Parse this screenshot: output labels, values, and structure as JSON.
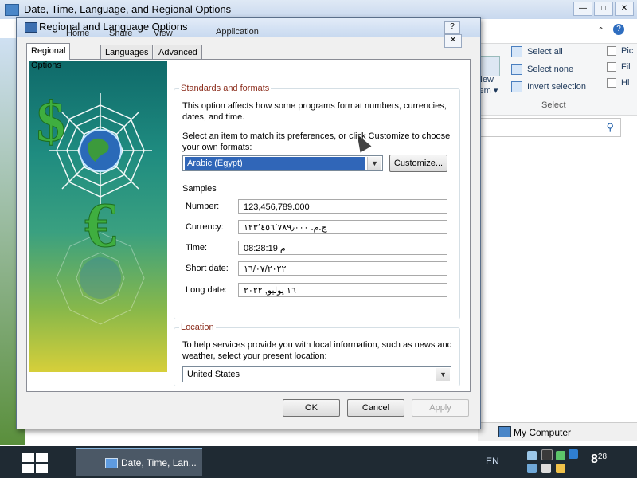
{
  "back_window": {
    "title": "Date, Time, Language, and Regional Options",
    "ribbon_tabs": [
      "Home",
      "Share",
      "View"
    ],
    "ribbon_app_tab": "Application",
    "select_all": "Select all",
    "select_none": "Select none",
    "invert_selection": "Invert selection",
    "select_group": "Select",
    "new_item_line1": "New",
    "new_item_line2": "item ▾",
    "check1": "Pic",
    "check2": "Fil",
    "check3": "Hi",
    "status": "My Computer"
  },
  "dialog": {
    "title": "Regional and Language Options",
    "tabs": [
      "Regional Options",
      "Languages",
      "Advanced"
    ],
    "standards": {
      "label": "Standards and formats",
      "desc": "This option affects how some programs format numbers, currencies, dates, and time.",
      "instruction": "Select an item to match its preferences, or click Customize to choose your own formats:",
      "selected_format": "Arabic (Egypt)",
      "customize_label": "Customize...",
      "samples_label": "Samples",
      "samples": [
        {
          "label": "Number:",
          "value": "123,456,789.000"
        },
        {
          "label": "Currency:",
          "value": "ج.م.‏ ١٢٣٬٤٥٦٬٧٨٩٫٠٠٠"
        },
        {
          "label": "Time:",
          "value": "08:28:19 م"
        },
        {
          "label": "Short date:",
          "value": "١٦/٠٧/٢٠٢٢"
        },
        {
          "label": "Long date:",
          "value": "١٦ يوليو, ٢٠٢٢"
        }
      ]
    },
    "location": {
      "label": "Location",
      "desc": "To help services provide you with local information, such as news and weather, select your present location:",
      "value": "United States"
    },
    "buttons": {
      "ok": "OK",
      "cancel": "Cancel",
      "apply": "Apply"
    }
  },
  "taskbar": {
    "task_label": "Date, Time, Lan...",
    "language": "EN",
    "clock_hour": "8",
    "clock_min": "28"
  }
}
